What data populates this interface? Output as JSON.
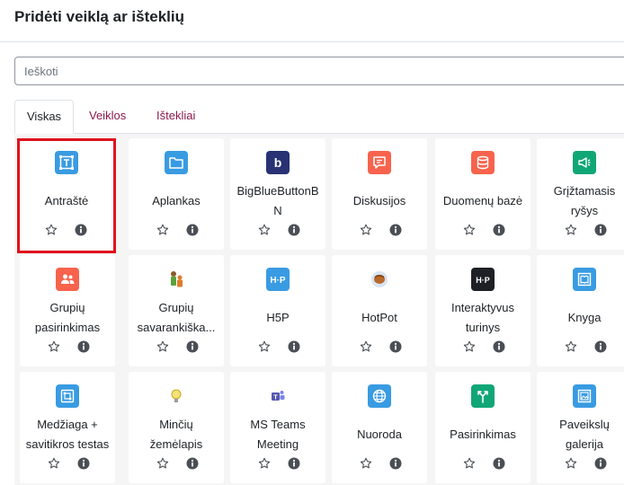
{
  "header": {
    "title": "Pridėti veiklą ar išteklių"
  },
  "search": {
    "placeholder": "Ieškoti"
  },
  "tabs": [
    {
      "label": "Viskas",
      "active": true
    },
    {
      "label": "Veiklos",
      "active": false
    },
    {
      "label": "Ištekliai",
      "active": false
    }
  ],
  "colors": {
    "selected_border": "#e0101c",
    "tab_link": "#8a1b4a",
    "grid_bg": "#f5f5f5"
  },
  "items": [
    {
      "label": "Antraštė",
      "icon": "text-area-icon",
      "color": "#399be2",
      "selected": true
    },
    {
      "label": "Aplankas",
      "icon": "folder-icon",
      "color": "#399be2"
    },
    {
      "label": "BigBlueButtonB\nN",
      "icon": "bigbluebutton-icon",
      "color": "#283274"
    },
    {
      "label": "Diskusijos",
      "icon": "forum-icon",
      "color": "#f7634d"
    },
    {
      "label": "Duomenų bazė",
      "icon": "database-icon",
      "color": "#f7634d"
    },
    {
      "label": "Grįžtamasis\nryšys",
      "icon": "feedback-icon",
      "color": "#11a676"
    },
    {
      "label": "Grupių\npasirinkimas",
      "icon": "group-choice-icon",
      "color": "#f7634d"
    },
    {
      "label": "Grupių\nsavarankiška...",
      "icon": "group-self-selection-icon",
      "color": "#5aa33c"
    },
    {
      "label": "H5P",
      "icon": "h5p-icon",
      "color": "#399be2"
    },
    {
      "label": "HotPot",
      "icon": "hotpot-icon",
      "color": "#5b9bd5"
    },
    {
      "label": "Interaktyvus\nturinys",
      "icon": "interactive-content-icon",
      "color": "#1d2125"
    },
    {
      "label": "Knyga",
      "icon": "book-icon",
      "color": "#399be2"
    },
    {
      "label": "Medžiaga +\nsavitikros testas",
      "icon": "material-quiz-icon",
      "color": "#399be2"
    },
    {
      "label": "Minčių\nžemėlapis",
      "icon": "mindmap-icon",
      "color": "#e2c93a"
    },
    {
      "label": "MS Teams\nMeeting",
      "icon": "ms-teams-icon",
      "color": "#5558af"
    },
    {
      "label": "Nuoroda",
      "icon": "url-globe-icon",
      "color": "#399be2"
    },
    {
      "label": "Pasirinkimas",
      "icon": "choice-icon",
      "color": "#11a676"
    },
    {
      "label": "Paveikslų\ngalerija",
      "icon": "image-gallery-icon",
      "color": "#399be2"
    }
  ]
}
